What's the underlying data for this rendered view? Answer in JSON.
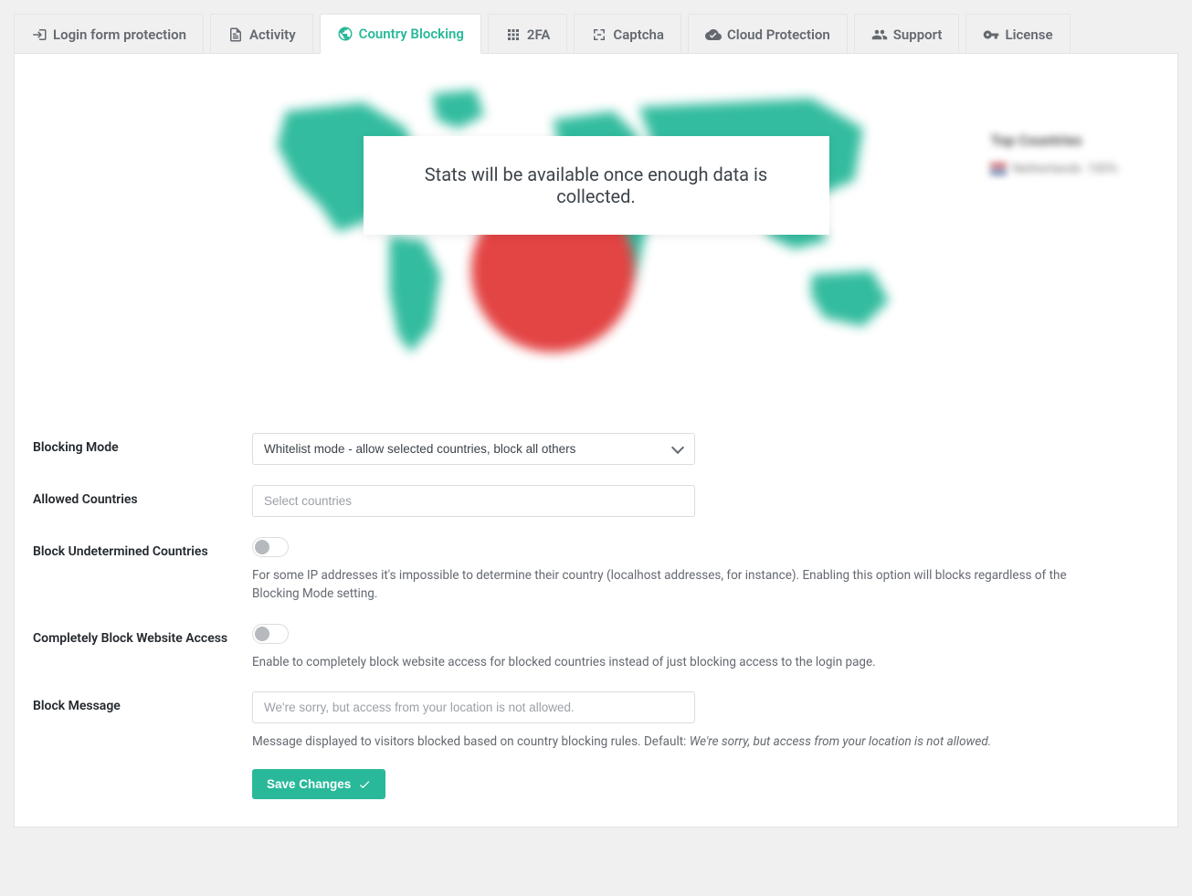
{
  "tabs": {
    "login": "Login form protection",
    "activity": "Activity",
    "country": "Country Blocking",
    "twofa": "2FA",
    "captcha": "Captcha",
    "cloud": "Cloud Protection",
    "support": "Support",
    "license": "License"
  },
  "stats_message": "Stats will be available once enough data is collected.",
  "top_countries": {
    "title": "Top Countries",
    "items": [
      {
        "country": "Netherlands",
        "pct": "100%"
      }
    ]
  },
  "form": {
    "blocking_mode": {
      "label": "Blocking Mode",
      "selected": "Whitelist mode - allow selected countries, block all others"
    },
    "allowed_countries": {
      "label": "Allowed Countries",
      "placeholder": "Select countries"
    },
    "block_undetermined": {
      "label": "Block Undetermined Countries",
      "help": "For some IP addresses it's impossible to determine their country (localhost addresses, for instance). Enabling this option will blocks regardless of the Blocking Mode setting."
    },
    "completely_block": {
      "label": "Completely Block Website Access",
      "help": "Enable to completely block website access for blocked countries instead of just blocking access to the login page."
    },
    "block_message": {
      "label": "Block Message",
      "placeholder": "We're sorry, but access from your location is not allowed.",
      "help_prefix": "Message displayed to visitors blocked based on country blocking rules. Default: ",
      "help_default": "We're sorry, but access from your location is not allowed."
    },
    "save": "Save Changes"
  }
}
